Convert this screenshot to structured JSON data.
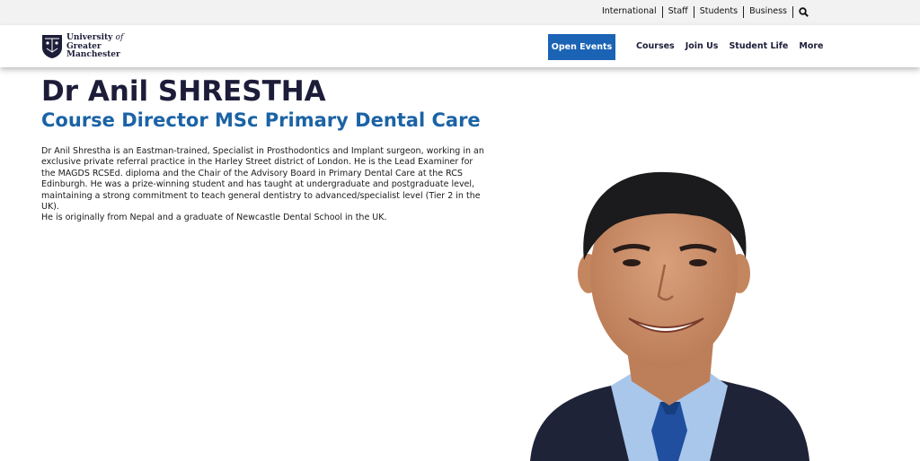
{
  "utility_nav": {
    "items": [
      "International",
      "Staff",
      "Students",
      "Business"
    ],
    "search_icon": "magnifier-icon"
  },
  "brand": {
    "line1": "University",
    "line1_suffix": "of",
    "line2": "Greater",
    "line3": "Manchester",
    "colors": {
      "navy": "#1d1d3a",
      "blue": "#1b63b5",
      "title_blue": "#1b63a5"
    }
  },
  "main_nav": {
    "cta": "Open Events",
    "items": [
      "Courses",
      "Join Us",
      "Student Life",
      "More"
    ]
  },
  "profile": {
    "name": "Dr Anil SHRESTHA",
    "role": "Course Director MSc Primary Dental Care",
    "bio_paragraph_1": "Dr Anil Shrestha is an Eastman-trained, Specialist in Prosthodontics and Implant surgeon, working in an exclusive private referral practice in the Harley Street district of London. He is the Lead Examiner for the MAGDS RCSEd. diploma and the Chair of the Advisory Board in Primary Dental Care at the RCS Edinburgh. He was a prize-winning student and has taught at undergraduate and postgraduate level, maintaining a strong commitment to teach general dentistry to advanced/specialist level (Tier 2 in the UK).",
    "bio_paragraph_2": "He is originally from Nepal and a graduate of Newcastle Dental School in the UK."
  }
}
